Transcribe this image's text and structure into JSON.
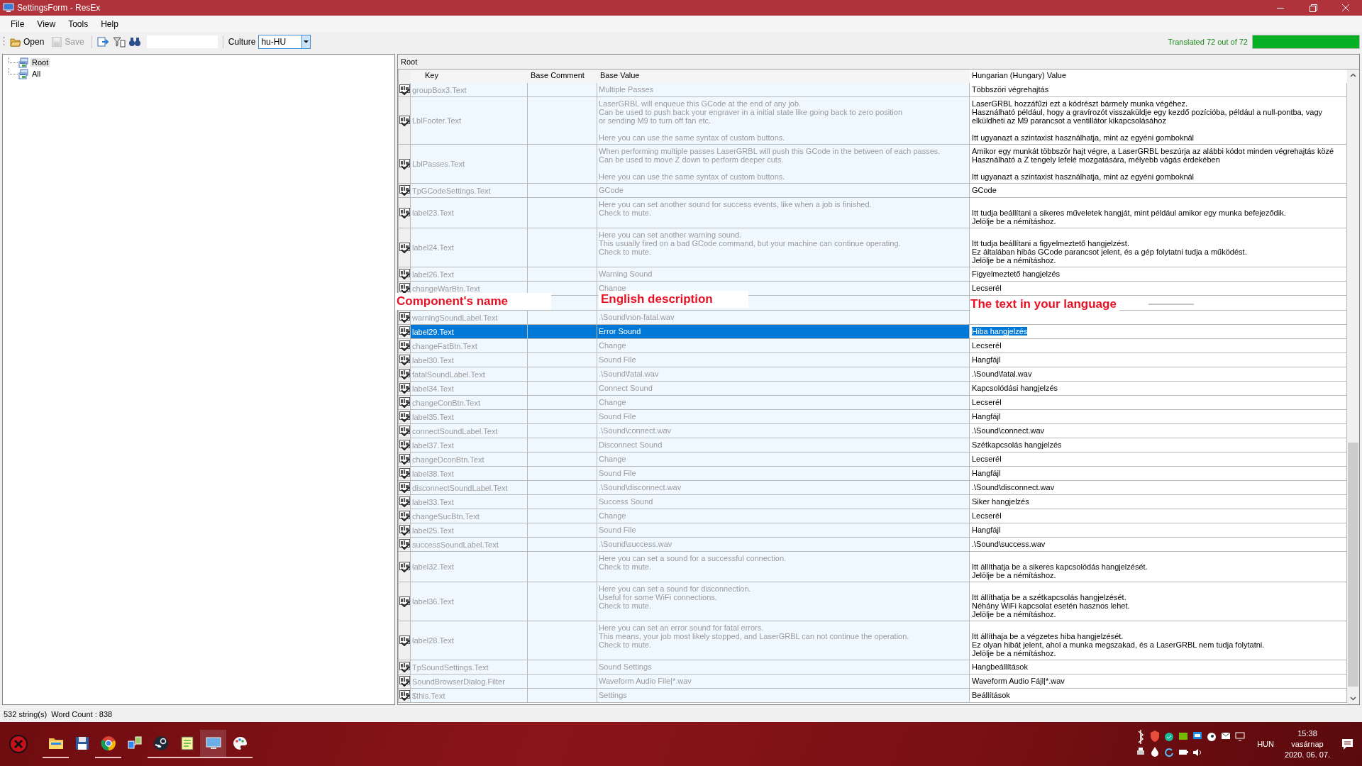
{
  "window": {
    "title": "SettingsForm - ResEx"
  },
  "menu": [
    "File",
    "View",
    "Tools",
    "Help"
  ],
  "toolbar": {
    "buttons": [
      {
        "kind": "open",
        "label": "Open",
        "disabled": false
      },
      {
        "kind": "save",
        "label": "Save",
        "disabled": true
      }
    ],
    "culture_label": "Culture",
    "culture": "hu-HU"
  },
  "progress": {
    "text": "Translated 72 out of 72",
    "level": 1
  },
  "tree": [
    {
      "label": "Root",
      "selected": true
    },
    {
      "label": "All",
      "selected": false
    }
  ],
  "panel_title": "Root",
  "table": {
    "columns": [
      "Key",
      "Base Comment",
      "Base Value",
      "Hungarian (Hungary) Value"
    ],
    "rows": [
      {
        "kind": "entry",
        "key": "groupBox3.Text",
        "base": "Multiple Passes",
        "value": "Többszöri végrehajtás",
        "selected": false
      },
      {
        "kind": "entry",
        "key": "LblFooter.Text",
        "base": "LaserGRBL will enqueue this GCode at the end of any job.\nCan be used to push back your engraver in a initial state like going back to zero position\nor sending M9 to turn off fan etc.\n\nHere you can use the same syntax of custom buttons.",
        "value": "LaserGRBL hozzáfűzi ezt a kódrészt bármely munka végéhez.\nHasználható például, hogy a gravírozót visszaküldje egy kezdő pozícióba, például a null-pontba, vagy\nelküldheti az M9 parancsot a ventillátor kikapcsolásához\n\nItt ugyanazt a szintaxist használhatja, mint az egyéni gomboknál",
        "selected": false
      },
      {
        "kind": "entry",
        "key": "LblPasses.Text",
        "base": "When performing multiple passes LaserGRBL will push this GCode in the between of each passes.\nCan be used to move Z down to perform deeper cuts.\n\nHere you can use the same syntax of custom buttons.",
        "value": "Amikor egy munkát többször hajt végre, a LaserGRBL beszúrja az alábbi kódot minden végrehajtás közé\nHasználható a Z tengely lefelé mozgatására, mélyebb vágás érdekében\n\nItt ugyanazt a szintaxist használhatja, mint az egyéni gomboknál",
        "selected": false
      },
      {
        "kind": "entry",
        "key": "TpGCodeSettings.Text",
        "base": "GCode",
        "value": "GCode",
        "selected": false
      },
      {
        "kind": "entry",
        "key": "label23.Text",
        "base": "Here you can set another sound for success events, like when a job is finished.\nCheck to mute.",
        "value": "\nItt tudja beállítani a sikeres műveletek hangját, mint például amikor egy munka befejeződik.\nJelölje be a némításhoz.",
        "selected": false
      },
      {
        "kind": "entry",
        "key": "label24.Text",
        "base": "Here you can set another warning sound.\nThis usually fired on a bad GCode command, but your machine can continue operating.\nCheck to mute.",
        "value": "\nItt tudja beállítani a figyelmeztető hangjelzést.\nEz általában hibás GCode parancsot jelent, és a gép folytatni tudja a működést.\nJelölje be a némításhoz.",
        "selected": false
      },
      {
        "kind": "entry",
        "key": "label26.Text",
        "base": "Warning Sound",
        "value": "Figyelmeztető hangjelzés",
        "selected": false
      },
      {
        "kind": "entry",
        "key": "changeWarBtn.Text",
        "base": "Change",
        "value": "Lecserél",
        "selected": false
      },
      {
        "kind": "callouts",
        "labels": [
          "Component's name",
          "English description",
          "The text in your language"
        ]
      },
      {
        "kind": "entry",
        "key": "warningSoundLabel.Text",
        "base": ".\\Sound\\non-fatal.wav",
        "selected": false
      },
      {
        "kind": "entry",
        "key": "label29.Text",
        "base": "Error Sound",
        "value": "Hiba hangjelzés",
        "selected": true
      },
      {
        "kind": "entry",
        "key": "changeFatBtn.Text",
        "base": "Change",
        "value": "Lecserél",
        "selected": false
      },
      {
        "kind": "entry",
        "key": "label30.Text",
        "base": "Sound File",
        "value": "Hangfájl",
        "selected": false
      },
      {
        "kind": "entry",
        "key": "fatalSoundLabel.Text",
        "base": ".\\Sound\\fatal.wav",
        "value": ".\\Sound\\fatal.wav",
        "selected": false
      },
      {
        "kind": "entry",
        "key": "label34.Text",
        "base": "Connect Sound",
        "value": "Kapcsolódási hangjelzés",
        "selected": false
      },
      {
        "kind": "entry",
        "key": "changeConBtn.Text",
        "base": "Change",
        "value": "Lecserél",
        "selected": false
      },
      {
        "kind": "entry",
        "key": "label35.Text",
        "base": "Sound File",
        "value": "Hangfájl",
        "selected": false
      },
      {
        "kind": "entry",
        "key": "connectSoundLabel.Text",
        "base": ".\\Sound\\connect.wav",
        "value": ".\\Sound\\connect.wav",
        "selected": false
      },
      {
        "kind": "entry",
        "key": "label37.Text",
        "base": "Disconnect Sound",
        "value": "Szétkapcsolás hangjelzés",
        "selected": false
      },
      {
        "kind": "entry",
        "key": "changeDconBtn.Text",
        "base": "Change",
        "value": "Lecserél",
        "selected": false
      },
      {
        "kind": "entry",
        "key": "label38.Text",
        "base": "Sound File",
        "value": "Hangfájl",
        "selected": false
      },
      {
        "kind": "entry",
        "key": "disconnectSoundLabel.Text",
        "base": ".\\Sound\\disconnect.wav",
        "value": ".\\Sound\\disconnect.wav",
        "selected": false
      },
      {
        "kind": "entry",
        "key": "label33.Text",
        "base": "Success Sound",
        "value": "Siker hangjelzés",
        "selected": false
      },
      {
        "kind": "entry",
        "key": "changeSucBtn.Text",
        "base": "Change",
        "value": "Lecserél",
        "selected": false
      },
      {
        "kind": "entry",
        "key": "label25.Text",
        "base": "Sound File",
        "value": "Hangfájl",
        "selected": false
      },
      {
        "kind": "entry",
        "key": "successSoundLabel.Text",
        "base": ".\\Sound\\success.wav",
        "value": ".\\Sound\\success.wav",
        "selected": false
      },
      {
        "kind": "entry",
        "key": "label32.Text",
        "base": "Here you can set a sound for a successful connection.\nCheck to mute.",
        "value": "\nItt állíthatja be a sikeres kapcsolódás hangjelzését.\nJelölje be a némításhoz.",
        "selected": false
      },
      {
        "kind": "entry",
        "key": "label36.Text",
        "base": "Here you can set a sound for disconnection.\nUseful for some WiFi connections.\nCheck to mute.",
        "value": "\nItt állíthatja be a szétkapcsolás hangjelzését.\nNéhány WiFi kapcsolat esetén hasznos lehet.\nJelölje be a némításhoz.",
        "selected": false
      },
      {
        "kind": "entry",
        "key": "label28.Text",
        "base": "Here you can set an error sound for fatal errors.\nThis means, your job most likely stopped, and LaserGRBL can not continue the operation.\nCheck to mute.",
        "value": "\nItt állíthaja be a végzetes hiba hangjelzését.\nEz olyan hibát jelent, ahol a munka megszakad, és a LaserGRBL nem tudja folytatni.\nJelölje be a némításhoz.",
        "selected": false
      },
      {
        "kind": "entry",
        "key": "TpSoundSettings.Text",
        "base": "Sound Settings",
        "value": "Hangbeállítások",
        "selected": false
      },
      {
        "kind": "entry",
        "key": "SoundBrowserDialog.Filter",
        "base": "Waveform Audio File|*.wav",
        "value": "Waveform Audio Fájl|*.wav",
        "selected": false
      },
      {
        "kind": "entry",
        "key": "$this.Text",
        "base": "Settings",
        "value": "Beállítások",
        "selected": false
      }
    ]
  },
  "status_bar": [
    "532 string(s)",
    "Word Count : 838"
  ],
  "taskbar": {
    "apps": [
      {
        "kind": "folder",
        "running": true,
        "active": false
      },
      {
        "kind": "disk",
        "running": false,
        "active": false
      },
      {
        "kind": "browser",
        "running": true,
        "active": false
      },
      {
        "kind": "network",
        "running": false,
        "active": false
      },
      {
        "kind": "steam",
        "running": true,
        "active": false
      },
      {
        "kind": "notepad",
        "running": true,
        "active": false
      },
      {
        "kind": "monitor",
        "running": true,
        "active": true
      },
      {
        "kind": "paint",
        "running": true,
        "active": false
      }
    ],
    "language": "HUN",
    "time": "15:38",
    "day": "vasárnap",
    "date": "2020. 06. 07."
  }
}
